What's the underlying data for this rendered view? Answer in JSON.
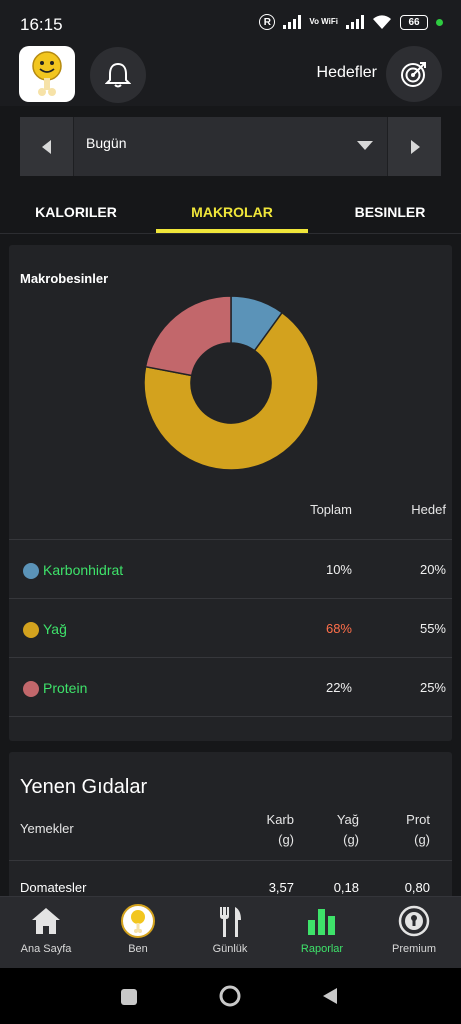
{
  "status": {
    "time": "16:15",
    "r_badge": "R",
    "network_label": "Vo WiFi",
    "battery": "66"
  },
  "header": {
    "goals_label": "Hedefler"
  },
  "date_selector": {
    "value": "Bugün"
  },
  "tabs": [
    {
      "label": "KALORILER",
      "active": false
    },
    {
      "label": "MAKROLAR",
      "active": true
    },
    {
      "label": "BESINLER",
      "active": false
    }
  ],
  "macros": {
    "title": "Makrobesinler",
    "col_total": "Toplam",
    "col_goal": "Hedef",
    "colors": {
      "carb": "#5b93b8",
      "fat": "#d3a21e",
      "protein": "#c2676b"
    },
    "rows": [
      {
        "name": "Karbonhidrat",
        "total": "10%",
        "goal": "20%",
        "total_color": "#f0f0f0"
      },
      {
        "name": "Yağ",
        "total": "68%",
        "goal": "55%",
        "total_color": "#ff6f4a"
      },
      {
        "name": "Protein",
        "total": "22%",
        "goal": "25%",
        "total_color": "#f0f0f0"
      }
    ]
  },
  "chart_data": {
    "type": "pie",
    "categories": [
      "Karbonhidrat",
      "Yağ",
      "Protein"
    ],
    "values": [
      10,
      68,
      22
    ],
    "colors": [
      "#5b93b8",
      "#d3a21e",
      "#c2676b"
    ],
    "title": "Makrobesinler"
  },
  "foods": {
    "title": "Yenen Gıdalar",
    "col_meals": "Yemekler",
    "col_carb": "Karb",
    "col_carb_unit": "(g)",
    "col_fat": "Yağ",
    "col_fat_unit": "(g)",
    "col_prot": "Prot",
    "col_prot_unit": "(g)",
    "rows": [
      {
        "name": "Domatesler",
        "carb": "3,57",
        "fat": "0,18",
        "prot": "0,80"
      }
    ]
  },
  "bottom_nav": [
    {
      "label": "Ana Sayfa",
      "icon": "home-icon",
      "active": false
    },
    {
      "label": "Ben",
      "icon": "avatar-icon",
      "active": false
    },
    {
      "label": "Günlük",
      "icon": "utensils-icon",
      "active": false
    },
    {
      "label": "Raporlar",
      "icon": "bar-chart-icon",
      "active": true
    },
    {
      "label": "Premium",
      "icon": "premium-badge-icon",
      "active": false
    }
  ]
}
